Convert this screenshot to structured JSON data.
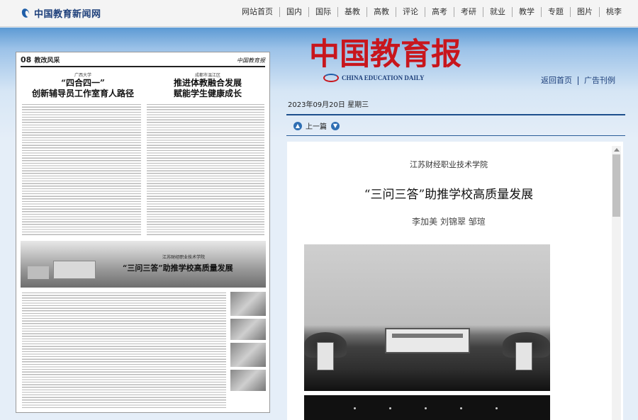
{
  "site": {
    "logo_text": "中国教育新闻网"
  },
  "nav": [
    "网站首页",
    "国内",
    "国际",
    "基教",
    "高教",
    "评论",
    "高考",
    "考研",
    "就业",
    "教学",
    "专题",
    "图片",
    "桃李"
  ],
  "masthead": {
    "title_cn": "中国教育报",
    "title_en": "CHINA EDUCATION DAILY"
  },
  "top_links": {
    "home": "返回首页",
    "ads": "广告刊例"
  },
  "dateline": "2023年09月20日  星期三",
  "pager": {
    "prev_label": "上一篇"
  },
  "page_thumb": {
    "page_no": "08",
    "section": "教改风采",
    "masthead": "中国教育报",
    "story1": {
      "kicker": "广西大学",
      "headline_1": "“四合四一”",
      "headline_2": "创新辅导员工作室育人路径"
    },
    "story2": {
      "kicker": "成都市温江区",
      "headline_1": "推进体教融合发展",
      "headline_2": "赋能学生健康成长"
    },
    "story3": {
      "kicker": "江苏财经职业技术学院",
      "headline": "“三问三答”助推学校高质量发展"
    }
  },
  "article": {
    "kicker": "江苏财经职业技术学院",
    "title": "“三问三答”助推学校高质量发展",
    "authors": "李加美  刘锦翠  邹瑄"
  }
}
